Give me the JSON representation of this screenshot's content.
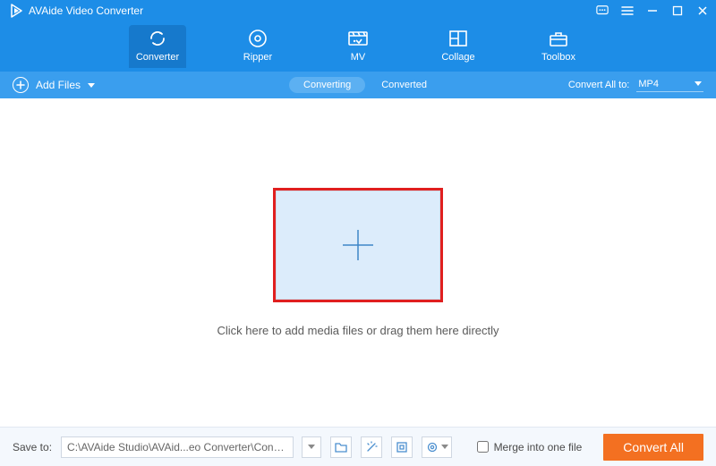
{
  "title": "AVAide Video Converter",
  "nav": {
    "converter": "Converter",
    "ripper": "Ripper",
    "mv": "MV",
    "collage": "Collage",
    "toolbox": "Toolbox"
  },
  "toolbar": {
    "add_files": "Add Files",
    "tab_converting": "Converting",
    "tab_converted": "Converted",
    "convert_all_label": "Convert All to:",
    "format_selected": "MP4"
  },
  "main": {
    "hint": "Click here to add media files or drag them here directly"
  },
  "bottom": {
    "save_to": "Save to:",
    "path": "C:\\AVAide Studio\\AVAid...eo Converter\\Converted",
    "merge_label": "Merge into one file",
    "convert_all": "Convert All"
  },
  "colors": {
    "brand_blue": "#1d8de7",
    "accent_orange": "#f37021",
    "highlight_red": "#e01f1f"
  }
}
